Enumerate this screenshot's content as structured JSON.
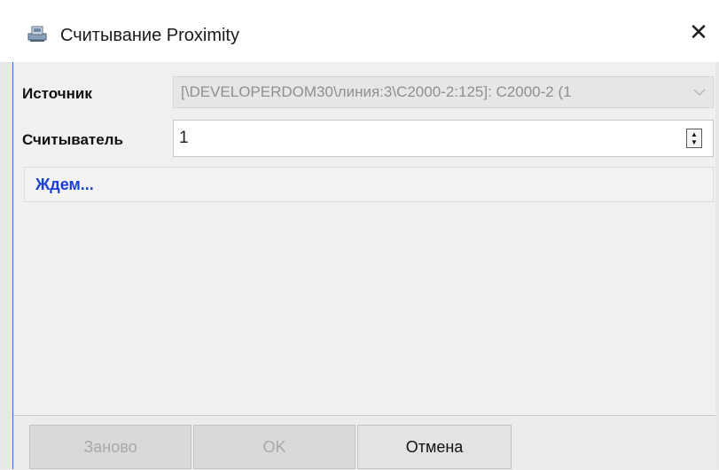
{
  "window": {
    "title": "Считывание Proximity",
    "title_icon": "device-icon",
    "close_glyph": "✕"
  },
  "form": {
    "source_label": "Источник",
    "source_value": "[\\DEVELOPERDOM30\\линия:3\\C2000-2:125]: C2000-2 (1",
    "reader_label": "Считыватель",
    "reader_value": "1"
  },
  "status": {
    "text": "Ждем..."
  },
  "buttons": {
    "retry": "Заново",
    "ok": "OK",
    "cancel": "Отмена"
  },
  "colors": {
    "status_text": "#1a3fd6",
    "disabled_text": "#a8a8a8"
  }
}
